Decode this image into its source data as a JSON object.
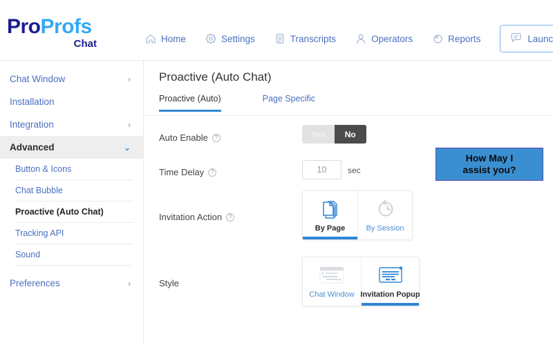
{
  "brand": {
    "name_part1": "Pro",
    "name_part2": "Profs",
    "sub": "Chat"
  },
  "header": {
    "nav": [
      {
        "label": "Home",
        "icon": "home-icon"
      },
      {
        "label": "Settings",
        "icon": "gear-icon"
      },
      {
        "label": "Transcripts",
        "icon": "document-icon"
      },
      {
        "label": "Operators",
        "icon": "user-icon"
      },
      {
        "label": "Reports",
        "icon": "pie-chart-icon"
      }
    ],
    "launch_label": "Launch Chat",
    "launch_icon": "chat-bubble-icon"
  },
  "sidebar": {
    "items": [
      {
        "label": "Chat Window",
        "chevron": "›"
      },
      {
        "label": "Installation",
        "chevron": ""
      },
      {
        "label": "Integration",
        "chevron": "›"
      }
    ],
    "advanced": {
      "label": "Advanced",
      "chevron": "⌄"
    },
    "sub_items": [
      {
        "label": "Button & Icons"
      },
      {
        "label": "Chat Bubble"
      },
      {
        "label": "Proactive (Auto Chat)"
      },
      {
        "label": "Tracking API"
      },
      {
        "label": "Sound"
      }
    ],
    "preferences": {
      "label": "Preferences",
      "chevron": "›"
    }
  },
  "main": {
    "title": "Proactive (Auto Chat)",
    "tabs": [
      {
        "label": "Proactive (Auto)"
      },
      {
        "label": "Page Specific"
      }
    ],
    "auto_enable": {
      "label": "Auto Enable",
      "help": "?",
      "yes_label": "Yes",
      "no_label": "No"
    },
    "time_delay": {
      "label": "Time Delay",
      "help": "?",
      "value": "10",
      "placeholder": "10",
      "unit": "sec"
    },
    "invitation_action": {
      "label": "Invitation Action",
      "help": "?",
      "options": [
        {
          "label": "By Page",
          "icon": "pages-stack-icon"
        },
        {
          "label": "By Session",
          "icon": "clock-history-icon"
        }
      ]
    },
    "style": {
      "label": "Style",
      "options": [
        {
          "label": "Chat Window",
          "icon": "chat-window-icon"
        },
        {
          "label": "Invitation Popup",
          "icon": "invitation-popup-icon"
        }
      ]
    }
  },
  "preview": {
    "line1": "How May I",
    "line2": "assist you?"
  },
  "colors": {
    "accent": "#2f86d4",
    "nav_link": "#4a6fbf",
    "brand_dark": "#1b1f8f",
    "brand_light": "#36a9f4",
    "popup_bg": "#3a8fd0"
  }
}
